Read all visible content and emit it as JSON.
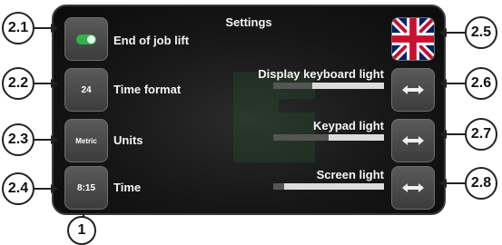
{
  "screen": {
    "title": "Settings"
  },
  "left_items": [
    {
      "button_text": "",
      "label": "End of job lift",
      "callout": "2.1"
    },
    {
      "button_text": "24",
      "label": "Time format",
      "callout": "2.2"
    },
    {
      "button_text": "Metric",
      "label": "Units",
      "callout": "2.3"
    },
    {
      "button_text": "8:15",
      "label": "Time",
      "callout": "2.4"
    }
  ],
  "right_items": [
    {
      "label": "Display keyboard light",
      "level": 0.35,
      "callout": "2.6"
    },
    {
      "label": "Keypad light",
      "level": 0.5,
      "callout": "2.7"
    },
    {
      "label": "Screen light",
      "level": 0.1,
      "callout": "2.8"
    }
  ],
  "language": {
    "flag": "uk-flag",
    "callout": "2.5"
  },
  "bottom_callout": "1",
  "colors": {
    "toggle_on": "#2fb34a",
    "bar_fill": "#dcdcdc",
    "screen_bg": "#161616"
  }
}
